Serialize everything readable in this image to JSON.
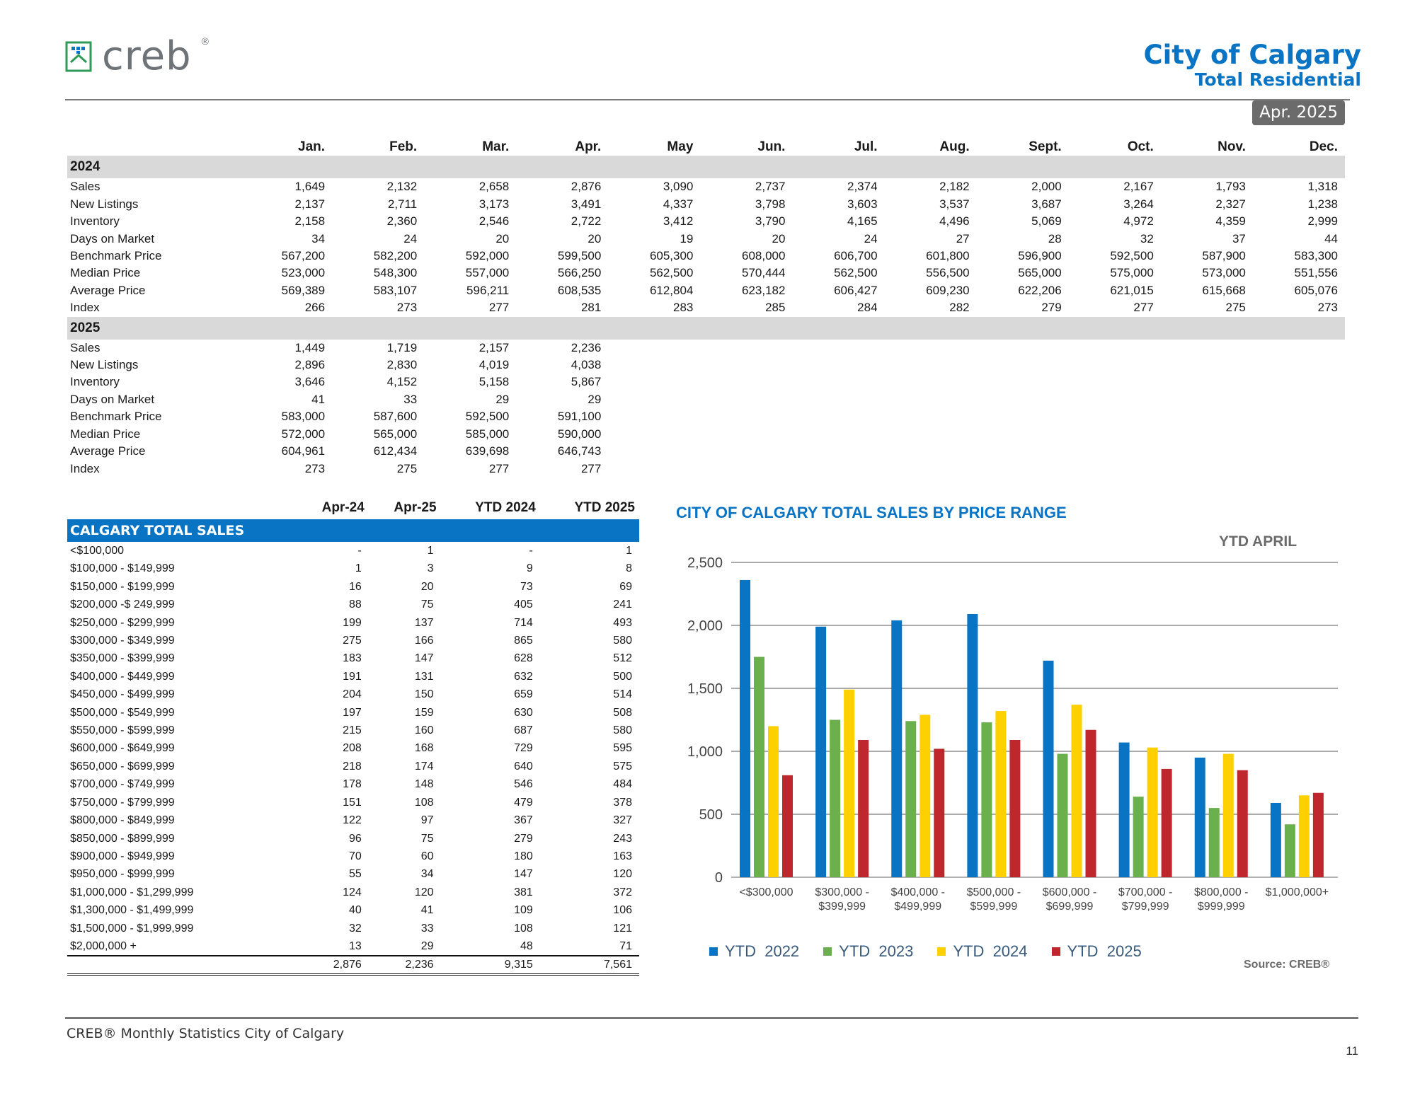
{
  "brand": {
    "name": "creb",
    "registered": "®"
  },
  "header": {
    "title": "City of Calgary",
    "subtitle": "Total Residential",
    "period": "Apr. 2025"
  },
  "monthly_table": {
    "months": [
      "Jan.",
      "Feb.",
      "Mar.",
      "Apr.",
      "May",
      "Jun.",
      "Jul.",
      "Aug.",
      "Sept.",
      "Oct.",
      "Nov.",
      "Dec."
    ],
    "years": [
      {
        "year": "2024",
        "rows": [
          {
            "label": "Sales",
            "values": [
              "1,649",
              "2,132",
              "2,658",
              "2,876",
              "3,090",
              "2,737",
              "2,374",
              "2,182",
              "2,000",
              "2,167",
              "1,793",
              "1,318"
            ]
          },
          {
            "label": "New Listings",
            "values": [
              "2,137",
              "2,711",
              "3,173",
              "3,491",
              "4,337",
              "3,798",
              "3,603",
              "3,537",
              "3,687",
              "3,264",
              "2,327",
              "1,238"
            ]
          },
          {
            "label": "Inventory",
            "values": [
              "2,158",
              "2,360",
              "2,546",
              "2,722",
              "3,412",
              "3,790",
              "4,165",
              "4,496",
              "5,069",
              "4,972",
              "4,359",
              "2,999"
            ]
          },
          {
            "label": "Days on Market",
            "values": [
              "34",
              "24",
              "20",
              "20",
              "19",
              "20",
              "24",
              "27",
              "28",
              "32",
              "37",
              "44"
            ]
          },
          {
            "label": "Benchmark Price",
            "values": [
              "567,200",
              "582,200",
              "592,000",
              "599,500",
              "605,300",
              "608,000",
              "606,700",
              "601,800",
              "596,900",
              "592,500",
              "587,900",
              "583,300"
            ]
          },
          {
            "label": "Median Price",
            "values": [
              "523,000",
              "548,300",
              "557,000",
              "566,250",
              "562,500",
              "570,444",
              "562,500",
              "556,500",
              "565,000",
              "575,000",
              "573,000",
              "551,556"
            ]
          },
          {
            "label": "Average Price",
            "values": [
              "569,389",
              "583,107",
              "596,211",
              "608,535",
              "612,804",
              "623,182",
              "606,427",
              "609,230",
              "622,206",
              "621,015",
              "615,668",
              "605,076"
            ]
          },
          {
            "label": "Index",
            "values": [
              "266",
              "273",
              "277",
              "281",
              "283",
              "285",
              "284",
              "282",
              "279",
              "277",
              "275",
              "273"
            ]
          }
        ]
      },
      {
        "year": "2025",
        "rows": [
          {
            "label": "Sales",
            "values": [
              "1,449",
              "1,719",
              "2,157",
              "2,236"
            ]
          },
          {
            "label": "New Listings",
            "values": [
              "2,896",
              "2,830",
              "4,019",
              "4,038"
            ]
          },
          {
            "label": "Inventory",
            "values": [
              "3,646",
              "4,152",
              "5,158",
              "5,867"
            ]
          },
          {
            "label": "Days on Market",
            "values": [
              "41",
              "33",
              "29",
              "29"
            ]
          },
          {
            "label": "Benchmark Price",
            "values": [
              "583,000",
              "587,600",
              "592,500",
              "591,100"
            ]
          },
          {
            "label": "Median Price",
            "values": [
              "572,000",
              "565,000",
              "585,000",
              "590,000"
            ]
          },
          {
            "label": "Average Price",
            "values": [
              "604,961",
              "612,434",
              "639,698",
              "646,743"
            ]
          },
          {
            "label": "Index",
            "values": [
              "273",
              "275",
              "277",
              "277"
            ]
          }
        ]
      }
    ]
  },
  "sales_table": {
    "columns": [
      "Apr-24",
      "Apr-25",
      "YTD 2024",
      "YTD 2025"
    ],
    "section_title": "CALGARY TOTAL SALES",
    "rows": [
      {
        "label": "<$100,000",
        "values": [
          "-",
          "1",
          "-",
          "1"
        ]
      },
      {
        "label": "$100,000 - $149,999",
        "values": [
          "1",
          "3",
          "9",
          "8"
        ]
      },
      {
        "label": "$150,000 - $199,999",
        "values": [
          "16",
          "20",
          "73",
          "69"
        ]
      },
      {
        "label": "$200,000 -$ 249,999",
        "values": [
          "88",
          "75",
          "405",
          "241"
        ]
      },
      {
        "label": "$250,000 - $299,999",
        "values": [
          "199",
          "137",
          "714",
          "493"
        ]
      },
      {
        "label": "$300,000 - $349,999",
        "values": [
          "275",
          "166",
          "865",
          "580"
        ]
      },
      {
        "label": "$350,000 - $399,999",
        "values": [
          "183",
          "147",
          "628",
          "512"
        ]
      },
      {
        "label": "$400,000 - $449,999",
        "values": [
          "191",
          "131",
          "632",
          "500"
        ]
      },
      {
        "label": "$450,000 - $499,999",
        "values": [
          "204",
          "150",
          "659",
          "514"
        ]
      },
      {
        "label": "$500,000 - $549,999",
        "values": [
          "197",
          "159",
          "630",
          "508"
        ]
      },
      {
        "label": "$550,000 - $599,999",
        "values": [
          "215",
          "160",
          "687",
          "580"
        ]
      },
      {
        "label": "$600,000 - $649,999",
        "values": [
          "208",
          "168",
          "729",
          "595"
        ]
      },
      {
        "label": "$650,000 - $699,999",
        "values": [
          "218",
          "174",
          "640",
          "575"
        ]
      },
      {
        "label": "$700,000 - $749,999",
        "values": [
          "178",
          "148",
          "546",
          "484"
        ]
      },
      {
        "label": "$750,000 - $799,999",
        "values": [
          "151",
          "108",
          "479",
          "378"
        ]
      },
      {
        "label": "$800,000 - $849,999",
        "values": [
          "122",
          "97",
          "367",
          "327"
        ]
      },
      {
        "label": "$850,000 - $899,999",
        "values": [
          "96",
          "75",
          "279",
          "243"
        ]
      },
      {
        "label": "$900,000 - $949,999",
        "values": [
          "70",
          "60",
          "180",
          "163"
        ]
      },
      {
        "label": "$950,000 - $999,999",
        "values": [
          "55",
          "34",
          "147",
          "120"
        ]
      },
      {
        "label": "$1,000,000 - $1,299,999",
        "values": [
          "124",
          "120",
          "381",
          "372"
        ]
      },
      {
        "label": "$1,300,000 - $1,499,999",
        "values": [
          "40",
          "41",
          "109",
          "106"
        ]
      },
      {
        "label": "$1,500,000 - $1,999,999",
        "values": [
          "32",
          "33",
          "108",
          "121"
        ]
      },
      {
        "label": "$2,000,000 +",
        "values": [
          "13",
          "29",
          "48",
          "71"
        ]
      }
    ],
    "totals": [
      "2,876",
      "2,236",
      "9,315",
      "7,561"
    ]
  },
  "chart_data": {
    "type": "bar",
    "title": "CITY OF CALGARY TOTAL SALES BY PRICE RANGE",
    "subtitle": "YTD  APRIL",
    "categories": [
      [
        "<$300,000"
      ],
      [
        "$300,000 -",
        "$399,999"
      ],
      [
        "$400,000 -",
        "$499,999"
      ],
      [
        "$500,000 -",
        "$599,999"
      ],
      [
        "$600,000 -",
        "$699,999"
      ],
      [
        "$700,000 -",
        "$799,999"
      ],
      [
        "$800,000 -",
        "$999,999"
      ],
      [
        "$1,000,000+"
      ]
    ],
    "series": [
      {
        "name": "YTD  2022",
        "color": "#0a74c4",
        "values": [
          2360,
          1990,
          2040,
          2090,
          1720,
          1070,
          950,
          590
        ]
      },
      {
        "name": "YTD  2023",
        "color": "#6ab04c",
        "values": [
          1750,
          1250,
          1240,
          1230,
          980,
          640,
          550,
          420
        ]
      },
      {
        "name": "YTD  2024",
        "color": "#ffd000",
        "values": [
          1200,
          1490,
          1290,
          1320,
          1370,
          1030,
          980,
          650
        ]
      },
      {
        "name": "YTD  2025",
        "color": "#c0272d",
        "values": [
          810,
          1090,
          1020,
          1090,
          1170,
          860,
          850,
          670
        ]
      }
    ],
    "ylim": [
      0,
      2500
    ],
    "yticks": [
      "0",
      "500",
      "1,000",
      "1,500",
      "2,000",
      "2,500"
    ],
    "ytick_values": [
      0,
      500,
      1000,
      1500,
      2000,
      2500
    ],
    "grid": true,
    "legend": "bottom",
    "source": "Source: CREB®"
  },
  "footer": {
    "text": "CREB® Monthly Statistics City of Calgary",
    "page": "11"
  }
}
